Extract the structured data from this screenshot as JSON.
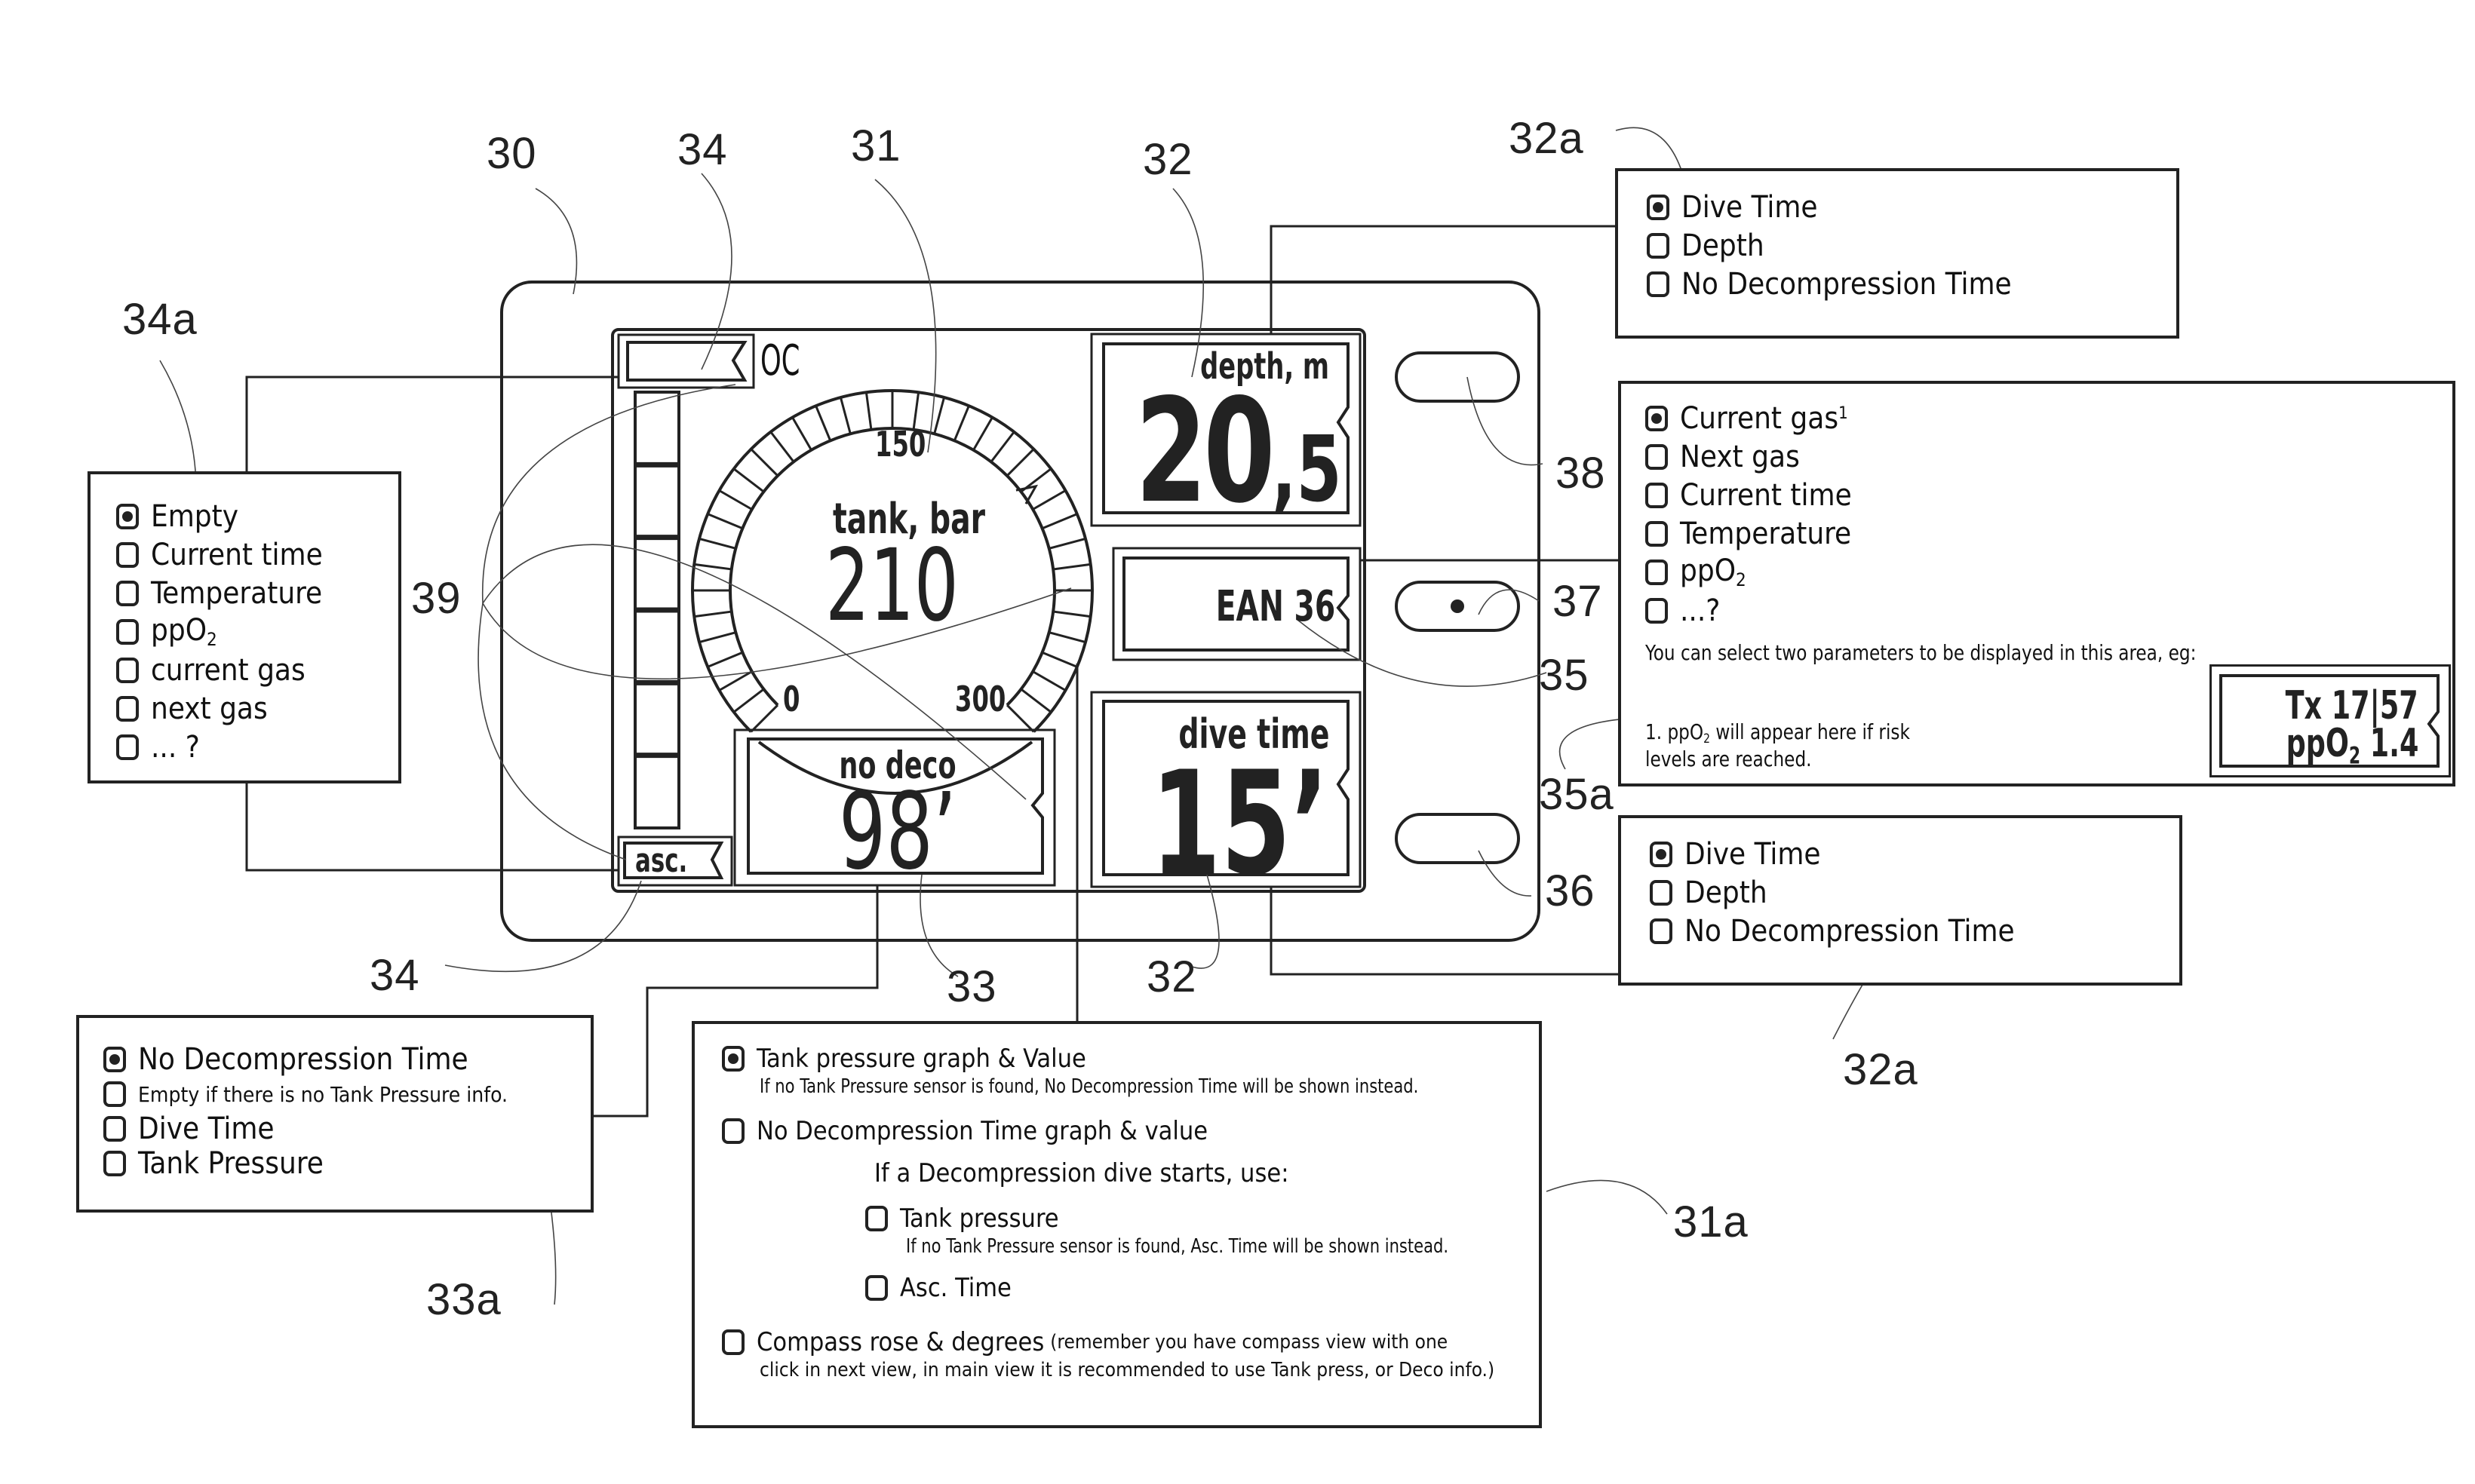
{
  "figure": {
    "reference_numerals": {
      "device": "30",
      "tank_gauge": "31",
      "tank_gauge_options": "31a",
      "depth_field_top": "32",
      "depth_field_bottom": "32",
      "field_options_top": "32a",
      "field_options_bottom": "32a",
      "nodeco_field": "33",
      "nodeco_options": "33a",
      "flag_top": "34",
      "flag_bottom": "34",
      "flag_options": "34a",
      "gas_field": "35",
      "gas_options": "35a",
      "button_bottom": "36",
      "button_middle": "37",
      "button_top": "38",
      "ascent_bar": "39"
    }
  },
  "device_screen": {
    "mode_label": "OC",
    "ascent_label": "asc.",
    "tank_gauge": {
      "title": "tank, bar",
      "value": "210",
      "scale_min": "0",
      "scale_mid": "150",
      "scale_max": "300",
      "value_fraction": 0.7
    },
    "depth_field": {
      "label": "depth, m",
      "value_int": "20",
      "value_dec": ",5"
    },
    "gas_field": {
      "value": "EAN 36"
    },
    "nodeco_field": {
      "label": "no deco",
      "value": "98’"
    },
    "dive_time_field": {
      "label": "dive time",
      "value": "15’"
    },
    "ascent_bar_segments": 6
  },
  "options_34a": {
    "items": [
      {
        "label": "Empty",
        "selected": true
      },
      {
        "label": "Current time",
        "selected": false
      },
      {
        "label": "Temperature",
        "selected": false
      },
      {
        "label": "ppO",
        "sub": "2",
        "selected": false
      },
      {
        "label": "current gas",
        "selected": false
      },
      {
        "label": "next gas",
        "selected": false
      },
      {
        "label": "... ?",
        "selected": false
      }
    ]
  },
  "options_32a_top": {
    "items": [
      {
        "label": "Dive Time",
        "selected": true
      },
      {
        "label": "Depth",
        "selected": false
      },
      {
        "label": "No Decompression Time",
        "selected": false
      }
    ]
  },
  "options_35a": {
    "items": [
      {
        "label": "Current gas",
        "sup": "1",
        "selected": true
      },
      {
        "label": "Next gas",
        "selected": false
      },
      {
        "label": "Current time",
        "selected": false
      },
      {
        "label": "Temperature",
        "selected": false
      },
      {
        "label": "ppO",
        "sub": "2",
        "selected": false
      },
      {
        "label": "...?",
        "selected": false
      }
    ],
    "note": "You can select two parameters to be displayed in this area, eg:",
    "footnote_line1_pre": "1. ppO",
    "footnote_sub": "2",
    "footnote_line1_post": " will appear here if risk",
    "footnote_line2": "levels are reached.",
    "example_line1": "Tx 17|57",
    "example_line2_pre": "ppO",
    "example_line2_sub": "2",
    "example_line2_post": " 1.4"
  },
  "options_32a_bottom": {
    "items": [
      {
        "label": "Dive Time",
        "selected": true
      },
      {
        "label": "Depth",
        "selected": false
      },
      {
        "label": "No Decompression Time",
        "selected": false
      }
    ]
  },
  "options_33a": {
    "items": [
      {
        "label": "No Decompression Time",
        "selected": true,
        "size": "lg"
      },
      {
        "label": "Empty if there is no Tank Pressure info.",
        "selected": false,
        "size": "sm"
      },
      {
        "label": "Dive Time",
        "selected": false,
        "size": "lg"
      },
      {
        "label": "Tank Pressure",
        "selected": false,
        "size": "lg"
      }
    ]
  },
  "options_31a": {
    "opt1_label": "Tank pressure graph & Value",
    "opt1_selected": true,
    "opt1_note": "If no Tank Pressure sensor is found, No Decompression Time will be shown instead.",
    "opt2_label": "No Decompression Time graph & value",
    "opt2_selected": false,
    "deco_heading": "If a Decompression dive starts, use:",
    "sub1_label": "Tank pressure",
    "sub1_selected": false,
    "sub1_note": "If no Tank Pressure sensor is found, Asc. Time will be shown instead.",
    "sub2_label": "Asc. Time",
    "sub2_selected": false,
    "opt3_label": "Compass rose & degrees",
    "opt3_selected": false,
    "opt3_note_a": "(remember you have compass view with one",
    "opt3_note_b": "click in next view, in main view it is recommended to use Tank press, or Deco info.)"
  }
}
